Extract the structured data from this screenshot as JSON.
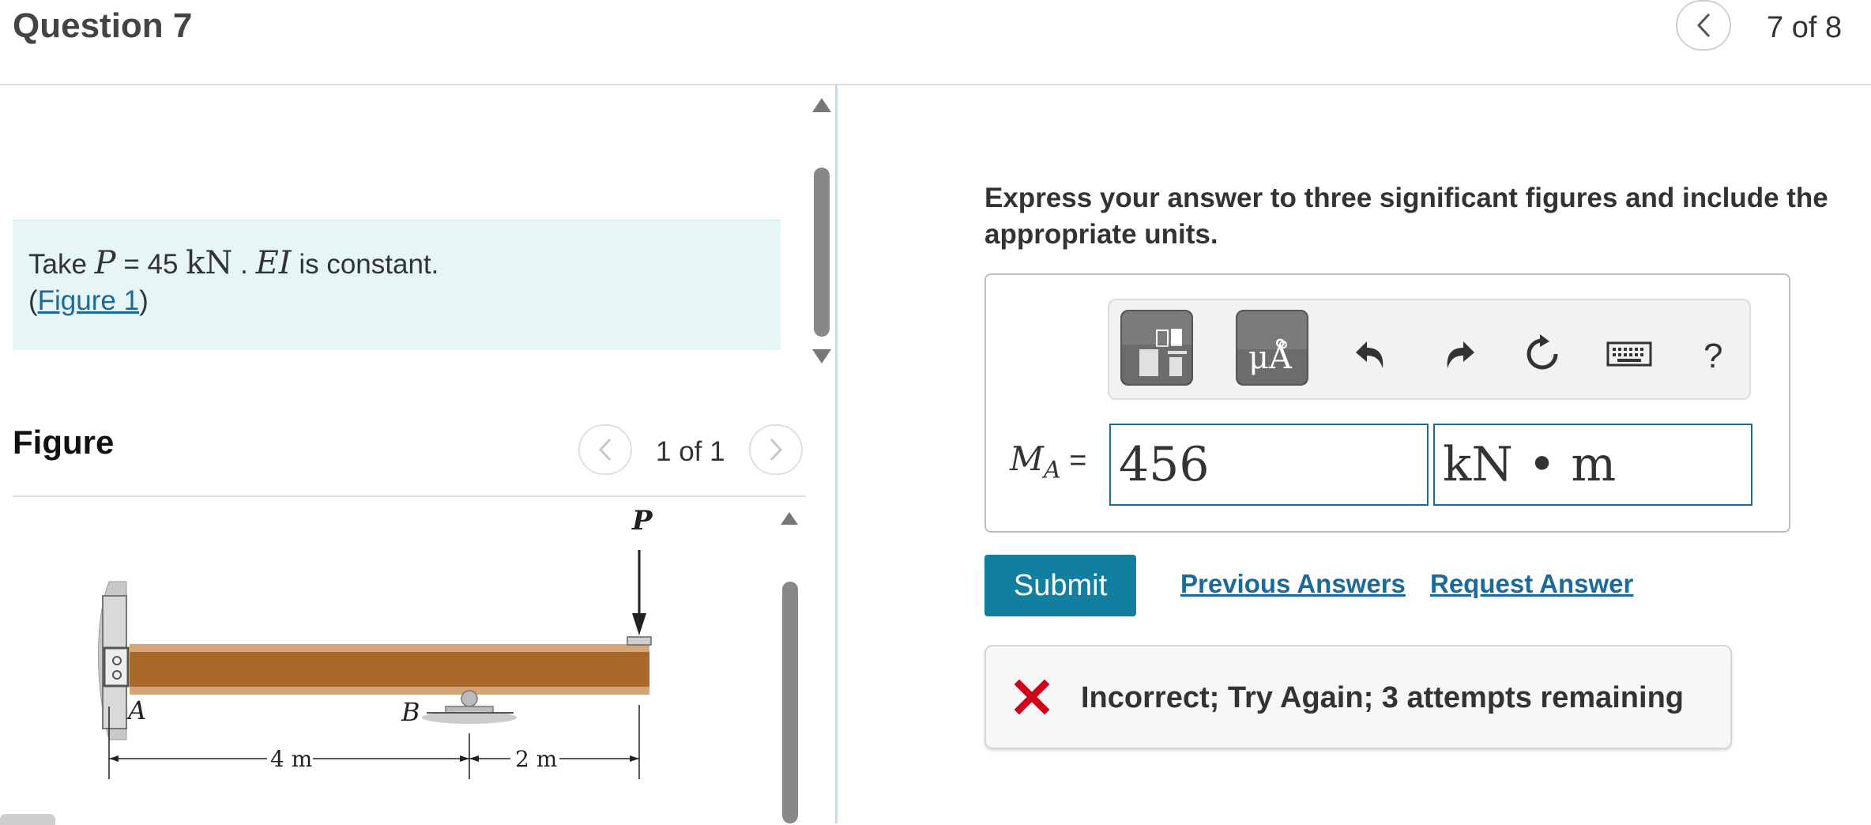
{
  "header": {
    "question_title": "Question 7",
    "nav_counter": "7 of 8"
  },
  "problem": {
    "take_label": "Take",
    "p_symbol": "P",
    "p_eq": " = 45",
    "p_unit": "kN",
    "sep": " . ",
    "ei_symbol": "EI",
    "ei_text": " is constant.",
    "figure_link": "Figure 1",
    "paren_open": "(",
    "paren_close": ")"
  },
  "figure": {
    "label": "Figure",
    "counter": "1 of 1",
    "labels": {
      "load": "P",
      "point_a": "A",
      "point_b": "B",
      "dim_left": "4 m",
      "dim_right": "2 m"
    }
  },
  "answer": {
    "instruction": "Express your answer to three significant figures and include the appropriate units.",
    "lhs_symbol": "M",
    "lhs_sub": "A",
    "lhs_eq": " =",
    "value": "456",
    "units": "kN • m",
    "toolbar": {
      "units_btn_label": "μÅ",
      "help_label": "?"
    }
  },
  "actions": {
    "submit": "Submit",
    "previous_answers": "Previous Answers",
    "request_answer": "Request Answer"
  },
  "feedback": {
    "text": "Incorrect; Try Again; 3 attempts remaining",
    "icon": "x-icon",
    "color": "#d0021b"
  },
  "colors": {
    "accent": "#137fa0",
    "link": "#1b6a9c",
    "problem_bg": "#e6f5f5",
    "beam": "#a9692a"
  }
}
